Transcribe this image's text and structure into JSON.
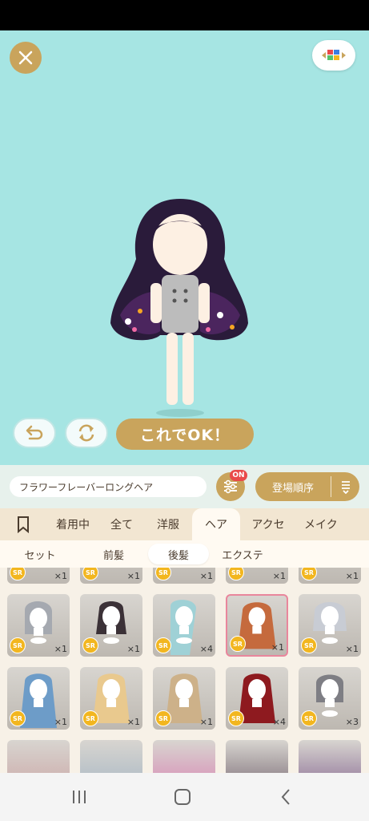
{
  "item_name": "フラワーフレーバーロングヘア",
  "ok_label": "これでOK！",
  "filter_badge": "ON",
  "sort_label": "登場順序",
  "tabs": [
    "着用中",
    "全て",
    "洋服",
    "ヘア",
    "アクセ",
    "メイク"
  ],
  "subtabs": [
    "セット",
    "前髪",
    "後髪",
    "エクステ"
  ],
  "rarity_label": "SR",
  "grid_rows": [
    {
      "counts": [
        "×1",
        "×1",
        "×1",
        "×1",
        "×1"
      ]
    },
    {
      "counts": [
        "×1",
        "×1",
        "×4",
        "×1",
        "×1"
      ]
    },
    {
      "counts": [
        "×1",
        "×1",
        "×1",
        "×4",
        "×3"
      ]
    }
  ],
  "colors": {
    "stage_bg": "#a6e5e3",
    "accent_gold": "#c9a45c",
    "badge_red": "#e94a4a",
    "selected_border": "#e9869c"
  },
  "icons": [
    "close-icon",
    "palette-icon",
    "undo-icon",
    "rotate-icon",
    "filter-icon",
    "sort-icon",
    "bookmark-icon",
    "sr-badge",
    "recent-apps-icon",
    "home-icon",
    "back-icon"
  ]
}
